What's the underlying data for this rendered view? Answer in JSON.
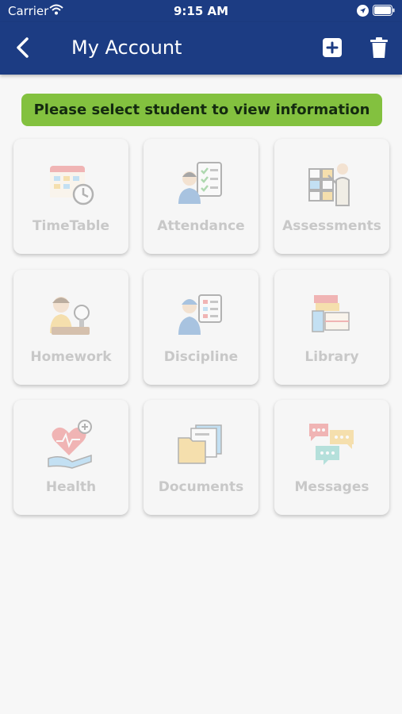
{
  "status_bar": {
    "carrier": "Carrier",
    "time": "9:15 AM"
  },
  "nav": {
    "title": "My Account",
    "back_icon": "chevron-left-icon",
    "add_icon": "plus-square-icon",
    "delete_icon": "trash-icon"
  },
  "notice": {
    "text": "Please select student to view information",
    "color": "#83c13f"
  },
  "tiles": [
    {
      "label": "TimeTable",
      "icon": "timetable-icon"
    },
    {
      "label": "Attendance",
      "icon": "attendance-icon"
    },
    {
      "label": "Assessments",
      "icon": "assessments-icon"
    },
    {
      "label": "Homework",
      "icon": "homework-icon"
    },
    {
      "label": "Discipline",
      "icon": "discipline-icon"
    },
    {
      "label": "Library",
      "icon": "library-icon"
    },
    {
      "label": "Health",
      "icon": "health-icon"
    },
    {
      "label": "Documents",
      "icon": "documents-icon"
    },
    {
      "label": "Messages",
      "icon": "messages-icon"
    }
  ],
  "colors": {
    "header": "#1c3c83",
    "background": "#f7f7f7",
    "disabled_label": "#c8c8c8"
  }
}
